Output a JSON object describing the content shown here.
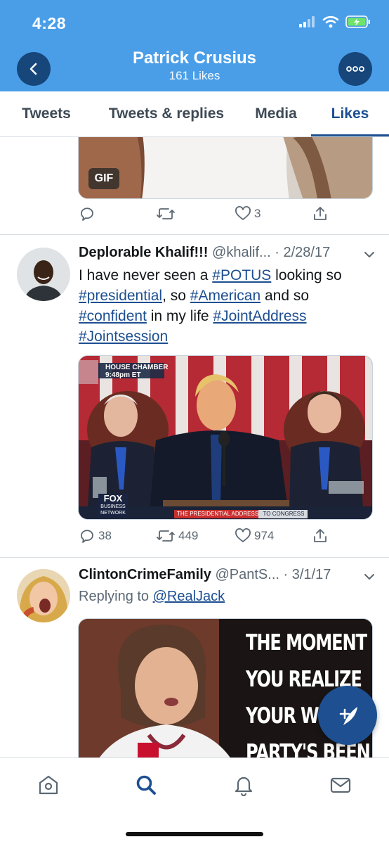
{
  "status_bar": {
    "time": "4:28"
  },
  "header": {
    "title": "Patrick Crusius",
    "subtitle": "161 Likes"
  },
  "tabs": [
    {
      "label": "Tweets"
    },
    {
      "label": "Tweets & replies"
    },
    {
      "label": "Media"
    },
    {
      "label": "Likes",
      "active": true
    }
  ],
  "tweets": [
    {
      "media_badge": "GIF",
      "actions": {
        "reply": "",
        "retweet": "",
        "like": "3"
      }
    },
    {
      "name": "Deplorable Khalif!!!",
      "handle": "@khalif...",
      "date": "· 2/28/17",
      "text_parts": [
        "I have never seen a ",
        "#POTUS",
        " looking so ",
        "#presidential",
        ", so ",
        "#American",
        " and so ",
        "#confident",
        " in my life ",
        "#JointAddress",
        " ",
        "#Jointsession"
      ],
      "media_overlay": {
        "bug_line1": "HOUSE CHAMBER",
        "bug_line2": "9:48pm ET",
        "logo_top": "FOX",
        "logo_mid": "BUSINESS",
        "logo_bottom": "NETWORK",
        "ticker_1": "THE PRESIDENTIAL ADDRESS",
        "ticker_2": "TO CONGRESS"
      },
      "actions": {
        "reply": "38",
        "retweet": "449",
        "like": "974"
      }
    },
    {
      "name": "ClintonCrimeFamily",
      "handle": "@PantS...",
      "date": "· 3/1/17",
      "replying_prefix": "Replying to ",
      "replying_to": "@RealJack",
      "meme_lines": [
        "THE MOMENT",
        "YOU REALIZE",
        "YOUR WHO",
        "PARTY'S BEEN"
      ]
    }
  ],
  "colors": {
    "header": "#4a9ee8",
    "accent": "#1d4f91",
    "muted": "#5b6873"
  }
}
